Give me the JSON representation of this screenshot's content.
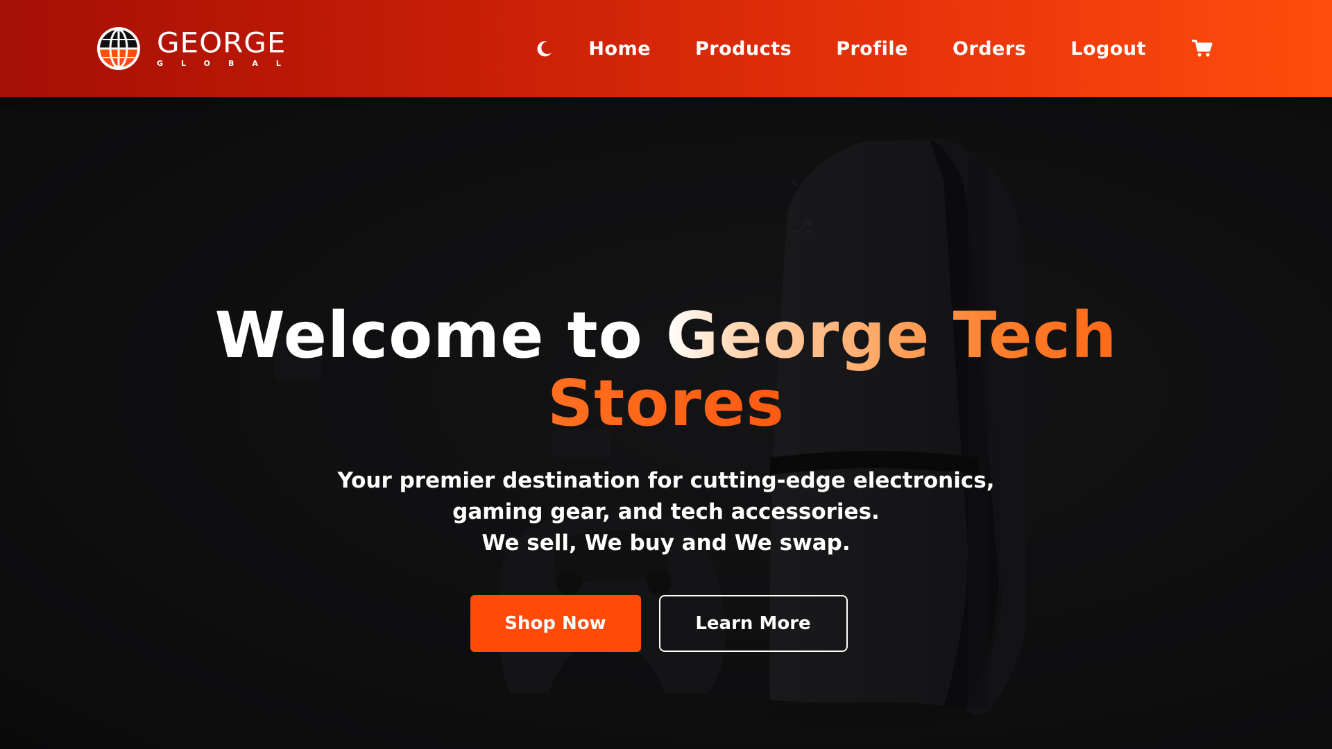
{
  "brand": {
    "name": "GEORGE",
    "subtitle": "GLOBAL",
    "logo_icon": "globe-logo-icon"
  },
  "nav": {
    "theme_toggle_icon": "moon-icon",
    "links": [
      {
        "label": "Home"
      },
      {
        "label": "Products"
      },
      {
        "label": "Profile"
      },
      {
        "label": "Orders"
      },
      {
        "label": "Logout"
      }
    ],
    "cart_icon": "cart-icon"
  },
  "hero": {
    "title_part1": "Welcome to ",
    "title_part2": "George Tech",
    "title_part3": "Stores",
    "desc_line1": "Your premier destination for cutting-edge electronics,",
    "desc_line2": "gaming gear, and tech accessories.",
    "desc_line3": "We sell, We buy and We swap.",
    "primary_button": "Shop Now",
    "secondary_button": "Learn More"
  },
  "colors": {
    "navbar_start": "#a40f06",
    "navbar_end": "#ff4d0d",
    "accent": "#ff4a0a",
    "background": "#0f0f0f"
  }
}
